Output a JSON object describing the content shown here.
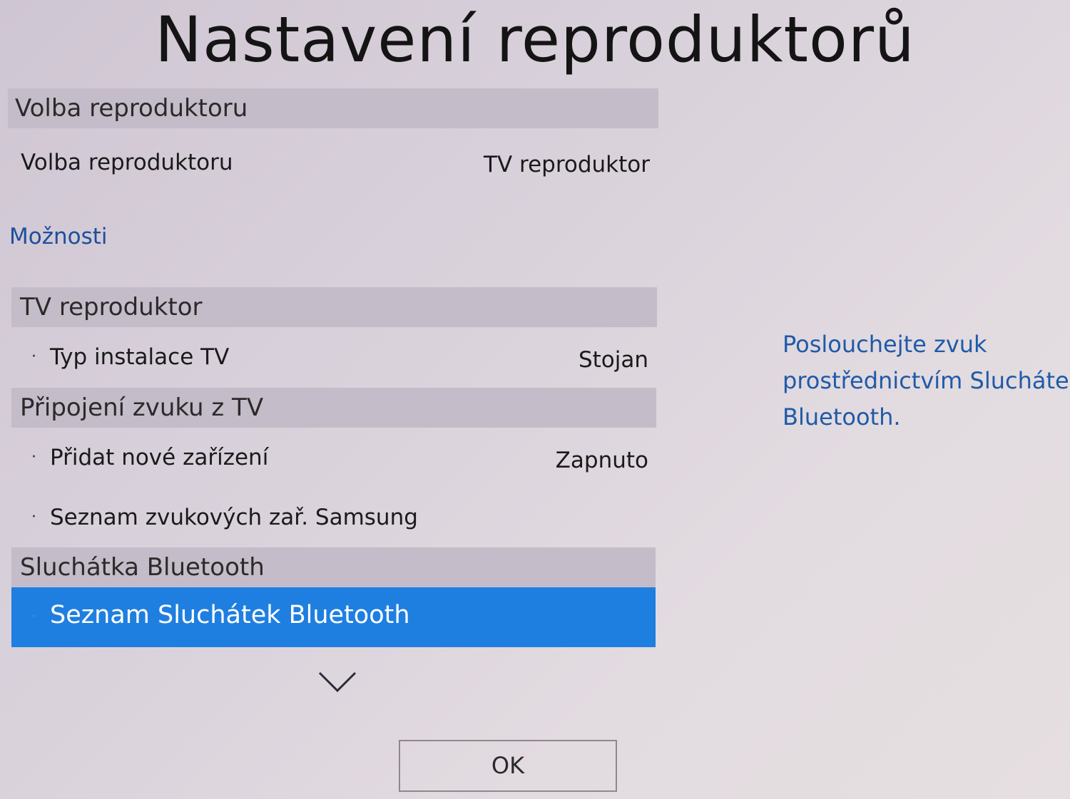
{
  "title": "Nastavení reproduktorů",
  "speaker_section": {
    "header": "Volba reproduktoru",
    "row": {
      "label": "Volba reproduktoru",
      "value": "TV reproduktor"
    }
  },
  "options_label": "Možnosti",
  "tv_speaker_section": {
    "header": "TV reproduktor",
    "row": {
      "bullet": "·",
      "label": "Typ instalace TV",
      "value": "Stojan"
    }
  },
  "tv_sound_connect_section": {
    "header": "Připojení zvuku z TV",
    "rows": [
      {
        "bullet": "·",
        "label": "Přidat nové zařízení",
        "value": "Zapnuto"
      },
      {
        "bullet": "·",
        "label": "Seznam zvukových zař. Samsung",
        "value": ""
      }
    ]
  },
  "bt_headphones_section": {
    "header": "Sluchátka Bluetooth",
    "row": {
      "bullet": "·",
      "label": "Seznam Sluchátek Bluetooth"
    }
  },
  "help_text": {
    "lines": [
      "Poslouchejte zvuk",
      "prostřednictvím Sluchátek",
      "Bluetooth."
    ]
  },
  "ok_label": "OK",
  "colors": {
    "selection": "#1f7fe0",
    "help_text": "#1f5aa8",
    "section_header_bg": "#c4bcc8"
  },
  "icons": {
    "scroll_more": "chevron-down-icon"
  }
}
